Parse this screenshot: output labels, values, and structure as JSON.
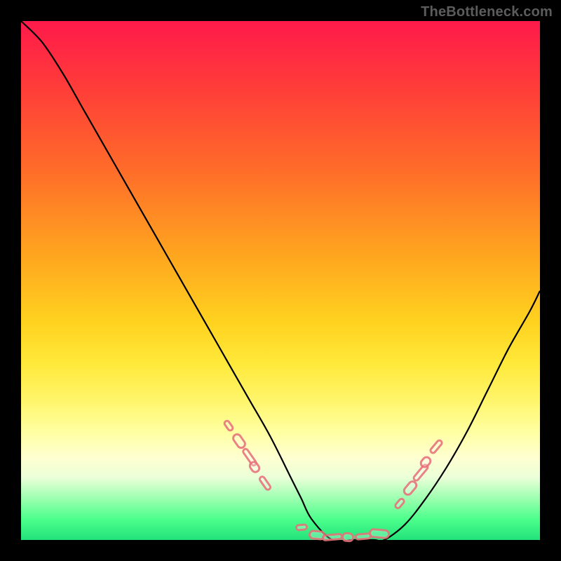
{
  "watermark": "TheBottleneck.com",
  "colors": {
    "frame": "#000000",
    "curve": "#000000",
    "marker_border": "#e66c76",
    "gradient_top": "#ff1a4b",
    "gradient_bottom": "#23e27a"
  },
  "chart_data": {
    "type": "line",
    "title": "",
    "xlabel": "",
    "ylabel": "",
    "xlim": [
      0,
      100
    ],
    "ylim": [
      0,
      100
    ],
    "grid": false,
    "legend": false,
    "series": [
      {
        "name": "bottleneck-curve",
        "x": [
          0,
          4,
          8,
          12,
          16,
          20,
          24,
          28,
          32,
          36,
          40,
          44,
          48,
          52,
          54,
          56,
          60,
          64,
          68,
          70,
          74,
          78,
          82,
          86,
          90,
          94,
          98,
          100
        ],
        "y": [
          100,
          96,
          90,
          83,
          76,
          69,
          62,
          55,
          48,
          41,
          34,
          27,
          20,
          12,
          8,
          4,
          0,
          0,
          0,
          0,
          3,
          8,
          14,
          21,
          29,
          37,
          44,
          48
        ]
      }
    ],
    "highlight_clusters": [
      {
        "name": "left-slope-cluster",
        "points": [
          {
            "x": 40,
            "y": 22
          },
          {
            "x": 42,
            "y": 19
          },
          {
            "x": 44,
            "y": 16
          },
          {
            "x": 45,
            "y": 14
          },
          {
            "x": 47,
            "y": 11
          }
        ]
      },
      {
        "name": "valley-cluster",
        "points": [
          {
            "x": 54,
            "y": 2.5
          },
          {
            "x": 57,
            "y": 1.0
          },
          {
            "x": 60,
            "y": 0.5
          },
          {
            "x": 63,
            "y": 0.5
          },
          {
            "x": 66,
            "y": 0.7
          },
          {
            "x": 69,
            "y": 1.2
          }
        ]
      },
      {
        "name": "right-slope-cluster",
        "points": [
          {
            "x": 73,
            "y": 7
          },
          {
            "x": 75,
            "y": 10
          },
          {
            "x": 77,
            "y": 13
          },
          {
            "x": 78,
            "y": 15
          },
          {
            "x": 80,
            "y": 18
          }
        ]
      }
    ]
  }
}
